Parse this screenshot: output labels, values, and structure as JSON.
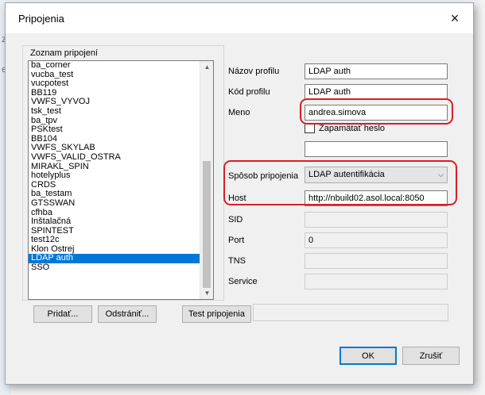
{
  "dialog": {
    "title": "Pripojenia",
    "close_glyph": "×"
  },
  "background": {
    "glyphs": [
      "z",
      "e"
    ]
  },
  "connections": {
    "group_label": "Zoznam pripojení",
    "items": [
      "ba_corner",
      "vucba_test",
      "vucpotest",
      "BB119",
      "VWFS_VYVOJ",
      "tsk_test",
      "ba_tpv",
      "PSKtest",
      "BB104",
      "VWFS_SKYLAB",
      "VWFS_VALID_OSTRA",
      "MIRAKL_SPIN",
      "hotelyplus",
      "CRDS",
      "ba_testam",
      "GTSSWAN",
      "cfhba",
      "Inštalačná",
      "SPINTEST",
      "test12c",
      "Klon Ostrej",
      "LDAP auth",
      "SSO"
    ],
    "selected_index": 21
  },
  "form": {
    "profile_name": {
      "label": "Názov profilu",
      "value": "LDAP auth"
    },
    "profile_code": {
      "label": "Kód profilu",
      "value": "LDAP auth"
    },
    "username": {
      "label": "Meno",
      "value": "andrea.simova"
    },
    "remember_password": {
      "label": "Zapamätať heslo",
      "checked": false
    },
    "password": {
      "value": ""
    },
    "connection_method": {
      "label": "Spôsob pripojenia",
      "value": "LDAP autentifikácia"
    },
    "host": {
      "label": "Host",
      "value": "http://nbuild02.asol.local:8050"
    },
    "sid": {
      "label": "SID",
      "value": ""
    },
    "port": {
      "label": "Port",
      "value": "0"
    },
    "tns": {
      "label": "TNS",
      "value": ""
    },
    "service": {
      "label": "Service",
      "value": ""
    }
  },
  "buttons": {
    "add": "Pridať...",
    "remove": "Odstrániť...",
    "test": "Test pripojenia",
    "ok": "OK",
    "cancel": "Zrušiť"
  },
  "colors": {
    "highlight_annotation": "#d81f26",
    "selection": "#0078d7"
  }
}
